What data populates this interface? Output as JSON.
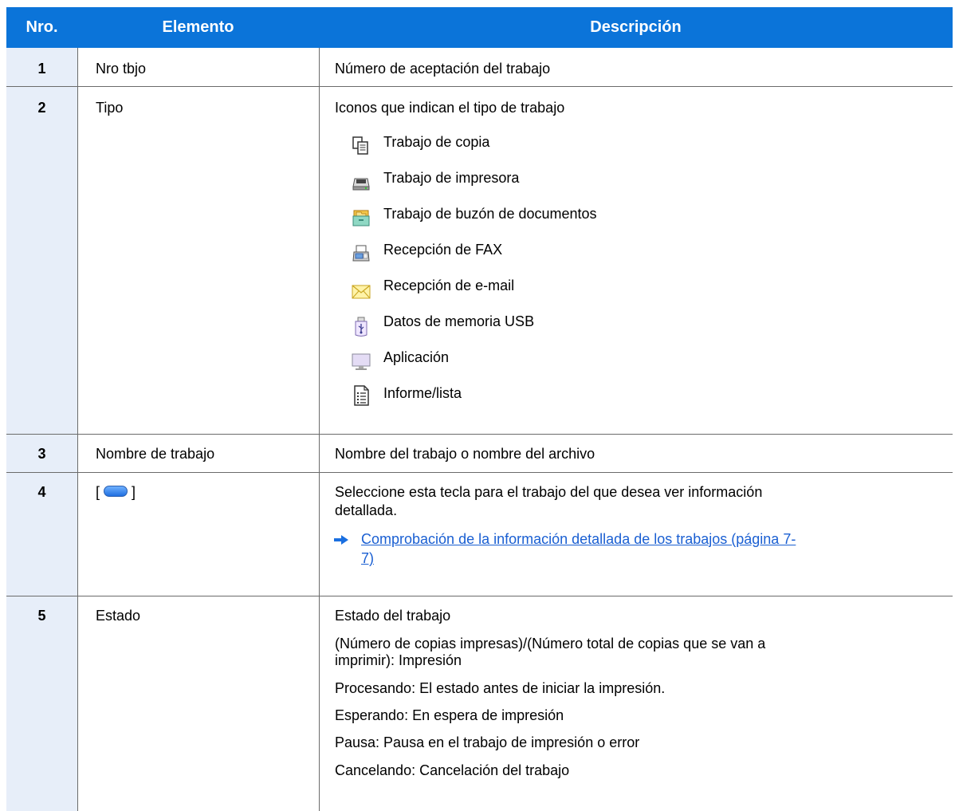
{
  "header": {
    "col1": "Nro.",
    "col2": "Elemento",
    "col3": "Descripción"
  },
  "rows": [
    {
      "num": "1",
      "element": "Nro tbjo",
      "desc": "Número de aceptación del trabajo"
    },
    {
      "num": "2",
      "element": "Tipo",
      "desc": "Iconos que indican el tipo de trabajo",
      "icons": [
        {
          "icon": "copy-job-icon",
          "label": "Trabajo de copia"
        },
        {
          "icon": "printer-job-icon",
          "label": "Trabajo de impresora"
        },
        {
          "icon": "document-box-job-icon",
          "label": "Trabajo de buzón de documentos"
        },
        {
          "icon": "fax-receive-icon",
          "label": "Recepción de FAX"
        },
        {
          "icon": "email-receive-icon",
          "label": "Recepción de e-mail"
        },
        {
          "icon": "usb-memory-icon",
          "label": "Datos de memoria USB"
        },
        {
          "icon": "application-icon",
          "label": "Aplicación"
        },
        {
          "icon": "report-list-icon",
          "label": "Informe/lista"
        }
      ]
    },
    {
      "num": "3",
      "element": "Nombre de trabajo",
      "desc": "Nombre del trabajo o nombre del archivo"
    },
    {
      "num": "4",
      "element_prefix": "[",
      "element_suffix": "]",
      "element_icon": "detail-key-icon",
      "desc_line1": "Seleccione esta tecla para el trabajo del que desea ver información",
      "desc_line2": "detallada.",
      "link_line1": "Comprobación de la información detallada de los trabajos (página 7-",
      "link_line2": "7)"
    },
    {
      "num": "5",
      "element": "Estado",
      "desc": "Estado del trabajo",
      "lines": [
        "(Número de copias impresas)/(Número total de copias que se van a",
        "imprimir): Impresión",
        "Procesando: El estado antes de iniciar la impresión.",
        "Esperando: En espera de impresión",
        "Pausa: Pausa en el trabajo de impresión o error",
        "Cancelando: Cancelación del trabajo"
      ]
    }
  ]
}
